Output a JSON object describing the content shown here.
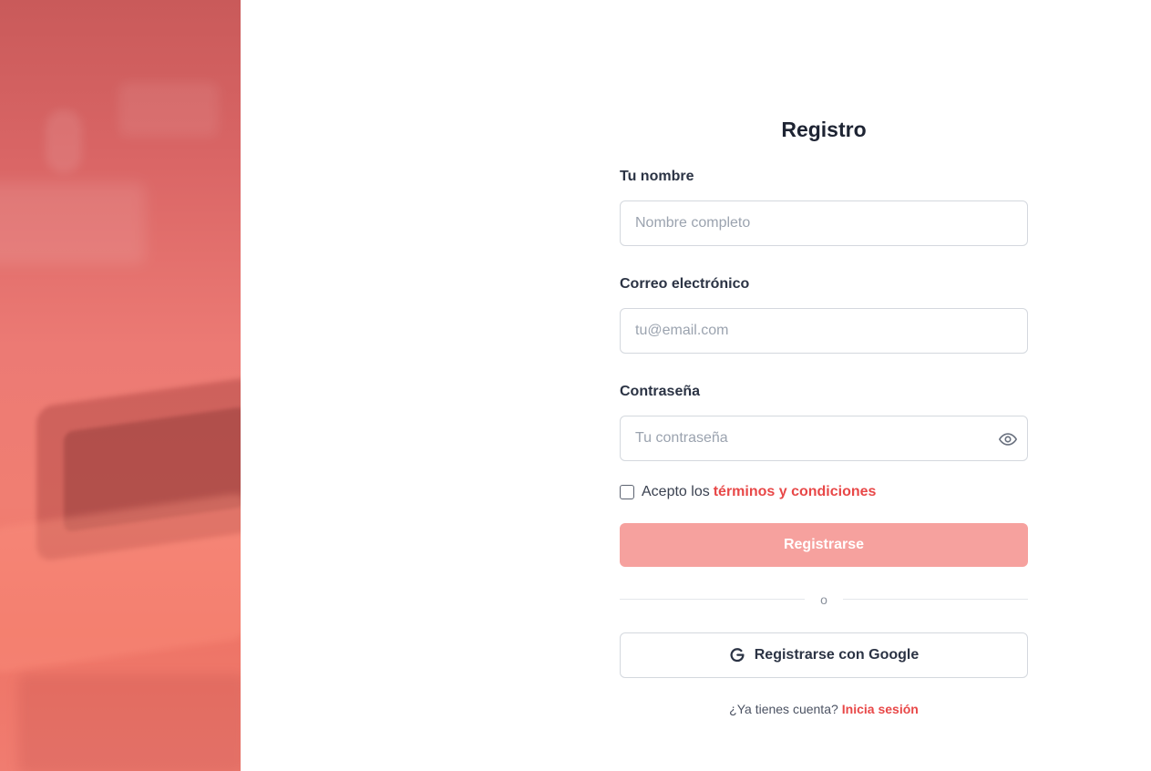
{
  "form": {
    "title": "Registro",
    "name_label": "Tu nombre",
    "name_placeholder": "Nombre completo",
    "name_value": "",
    "email_label": "Correo electrónico",
    "email_placeholder": "tu@email.com",
    "email_value": "",
    "password_label": "Contraseña",
    "password_placeholder": "Tu contraseña",
    "password_value": "",
    "terms_prefix": "Acepto los",
    "terms_link": "términos y condiciones",
    "submit_label": "Registrarse",
    "divider_text": "o",
    "google_label": "Registrarse con Google",
    "login_question": "¿Ya tienes cuenta?",
    "login_link": "Inicia sesión"
  },
  "icons": {
    "password_toggle": "eye-icon",
    "google": "google-g-icon"
  },
  "colors": {
    "accent": "#e84848",
    "submit_button": "#f6a19e",
    "hero_overlay": "#e06a68"
  }
}
